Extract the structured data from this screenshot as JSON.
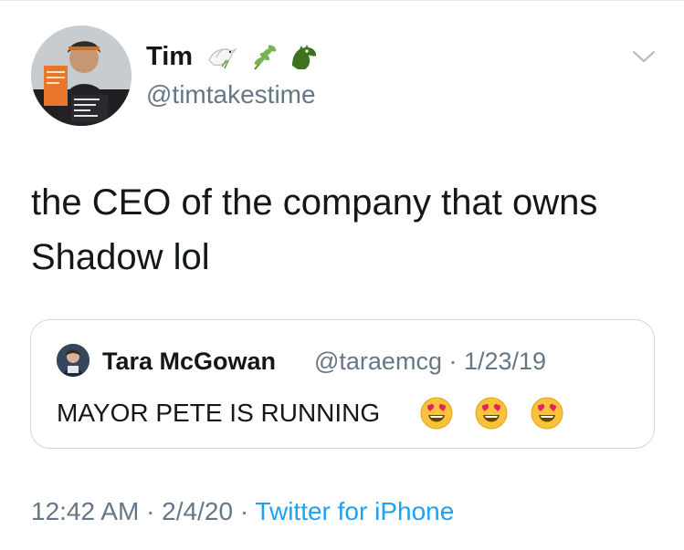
{
  "tweet": {
    "author": {
      "display_name": "Tim",
      "handle": "@timtakestime",
      "avatar_icon": "profile-photo",
      "avatar_sign_text": "ALACHUA COUNTY LABOR COALITION",
      "name_emojis": [
        "dove-emoji",
        "herb-emoji",
        "crocodile-emoji"
      ]
    },
    "menu_icon": "chevron-down-icon",
    "text_line1": "the CEO of the company that owns",
    "text_line2": "Shadow lol",
    "quoted": {
      "display_name": "Tara McGowan",
      "handle_and_date": "@taraemcg · 1/23/19",
      "text": "MAYOR PETE IS RUNNING",
      "emojis": [
        "heart-eyes-emoji",
        "heart-eyes-emoji",
        "heart-eyes-emoji"
      ]
    },
    "footer": {
      "timestamp": "12:42 AM · 2/4/20 · ",
      "source": "Twitter for iPhone"
    }
  },
  "colors": {
    "text": "#14171a",
    "secondary": "#657786",
    "link": "#1da1f2",
    "border": "#ccd6dd"
  }
}
